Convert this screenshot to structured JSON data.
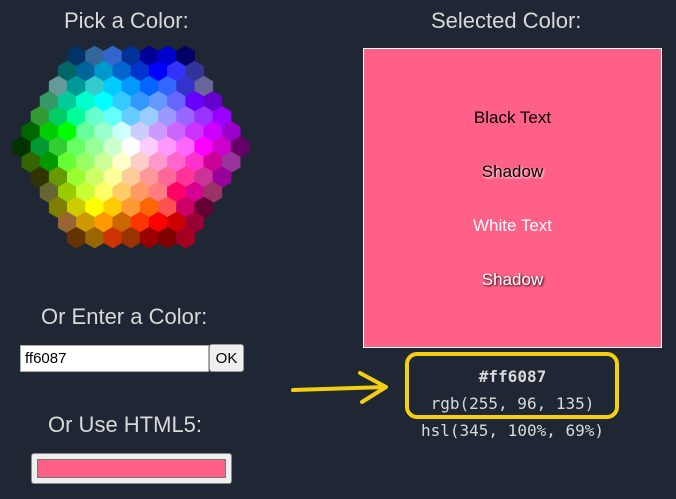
{
  "headings": {
    "pick": "Pick a Color:",
    "selected": "Selected Color:",
    "enter": "Or Enter a Color:",
    "html5": "Or Use HTML5:"
  },
  "input": {
    "value": "ff6087",
    "ok_label": "OK"
  },
  "selected_color": "#ff6087",
  "preview": {
    "black_text": "Black Text",
    "black_shadow": "Shadow",
    "white_text": "White Text",
    "white_shadow": "Shadow"
  },
  "codes": {
    "hex": "#ff6087",
    "rgb": "rgb(255, 96, 135)",
    "hsl": "hsl(345, 100%, 69%)"
  },
  "colors": {
    "background": "#1f2634",
    "highlight": "#f4ce10",
    "arrow": "#f4ce10"
  },
  "hex_map_rows": [
    [
      "#003366",
      "#336699",
      "#3366CC",
      "#003399",
      "#000099",
      "#0000CC",
      "#000066"
    ],
    [
      "#006666",
      "#006699",
      "#0099CC",
      "#0066CC",
      "#0033CC",
      "#0000FF",
      "#3333FF",
      "#333399"
    ],
    [
      "#669999",
      "#009999",
      "#33CCCC",
      "#00CCFF",
      "#0099FF",
      "#0066FF",
      "#3366FF",
      "#3333CC",
      "#666699"
    ],
    [
      "#339966",
      "#00CC99",
      "#00FFCC",
      "#00FFFF",
      "#33CCFF",
      "#3399FF",
      "#6699FF",
      "#6666FF",
      "#6600FF",
      "#6600CC"
    ],
    [
      "#339933",
      "#00CC66",
      "#00FF99",
      "#66FFCC",
      "#66FFFF",
      "#66CCFF",
      "#99CCFF",
      "#9999FF",
      "#9966FF",
      "#9933FF",
      "#9900FF"
    ],
    [
      "#006600",
      "#00CC00",
      "#00FF00",
      "#66FF99",
      "#99FFCC",
      "#CCFFFF",
      "#CCCCFF",
      "#CC99FF",
      "#CC66FF",
      "#CC33FF",
      "#CC00FF",
      "#9900CC"
    ],
    [
      "#003300",
      "#009933",
      "#33CC33",
      "#66FF66",
      "#99FF99",
      "#CCFFCC",
      "#FFFFFF",
      "#FFCCFF",
      "#FF99FF",
      "#FF66FF",
      "#FF00FF",
      "#CC00CC",
      "#660066"
    ],
    [
      "#336600",
      "#009900",
      "#66FF33",
      "#99FF66",
      "#CCFF99",
      "#FFFFCC",
      "#FFCCCC",
      "#FF99CC",
      "#FF66CC",
      "#FF33CC",
      "#CC0099",
      "#993399"
    ],
    [
      "#333300",
      "#669900",
      "#99FF33",
      "#CCFF66",
      "#FFFF99",
      "#FFCC99",
      "#FF9999",
      "#FF6699",
      "#FF3399",
      "#CC3399",
      "#990099"
    ],
    [
      "#666633",
      "#99CC00",
      "#CCFF33",
      "#FFFF66",
      "#FFCC66",
      "#FF9966",
      "#FF7C80",
      "#FF0066",
      "#D60093",
      "#993366"
    ],
    [
      "#808000",
      "#CCCC00",
      "#FFFF00",
      "#FFCC00",
      "#FF9933",
      "#FF6600",
      "#FF5050",
      "#CC0066",
      "#660033"
    ],
    [
      "#996633",
      "#CC9900",
      "#FF9900",
      "#CC6600",
      "#FF3300",
      "#FF0000",
      "#CC0000",
      "#990033"
    ],
    [
      "#663300",
      "#996600",
      "#CC3300",
      "#993300",
      "#990000",
      "#800000",
      "#A50021"
    ]
  ]
}
